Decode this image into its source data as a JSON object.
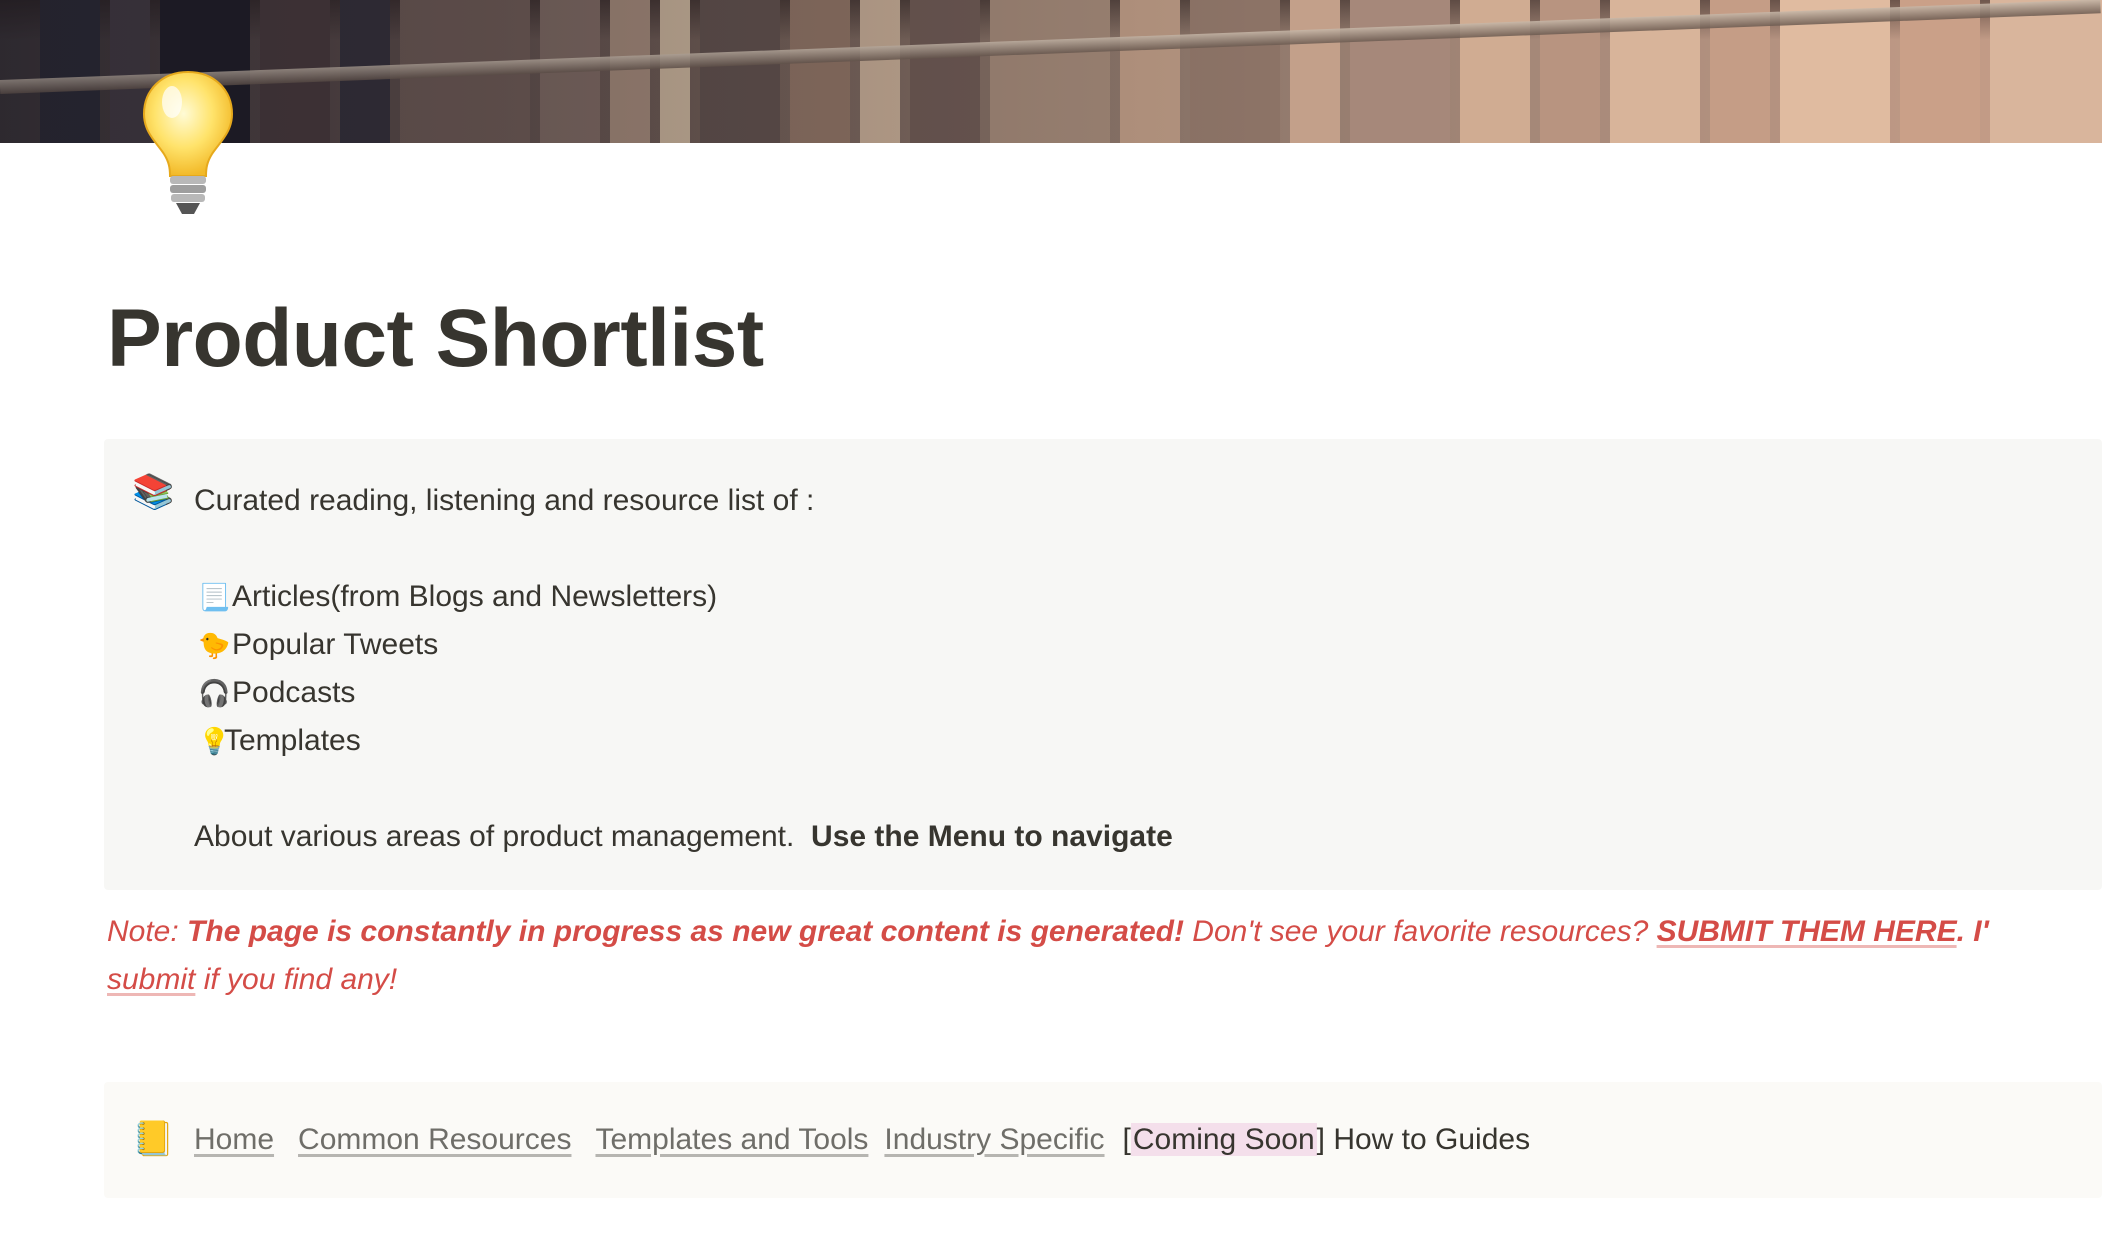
{
  "page": {
    "title": "Product Shortlist",
    "icon": "lightbulb-icon"
  },
  "callout": {
    "icon": "books-icon",
    "intro": "Curated reading, listening and resource list of :",
    "items": [
      {
        "icon": "scroll-icon",
        "emoji": "📃",
        "label": "Articles(from Blogs and Newsletters)"
      },
      {
        "icon": "chick-icon",
        "emoji": "🐤",
        "label": "Popular Tweets"
      },
      {
        "icon": "headphones-icon",
        "emoji": "🎧",
        "label": "Podcasts"
      },
      {
        "icon": "lightbulb-icon",
        "emoji": "💡",
        "label": "Templates"
      }
    ],
    "about": "About various areas of product management.",
    "about_bold": "Use the Menu to navigate"
  },
  "note": {
    "prefix": "Note: ",
    "strong": "The page is constantly in progress as new great content is generated!",
    "middle": " Don't see your favorite resources? ",
    "link1": "SUBMIT THEM HERE",
    "after_link1": ". I'",
    "link2": "submit",
    "suffix": " if you find any!"
  },
  "menu": {
    "icon": "notebook-icon",
    "links": [
      "Home",
      "Common Resources",
      "Templates and Tools",
      "Industry Specific"
    ],
    "coming_soon_open": "[",
    "coming_soon": "Coming Soon",
    "coming_soon_close": "]",
    "last_label": " How to Guides"
  },
  "colors": {
    "note_red": "#d44c47",
    "callout_bg": "#f7f7f5",
    "menu_bg": "#fbfaf7",
    "highlight_pink": "#f4dfeb"
  }
}
